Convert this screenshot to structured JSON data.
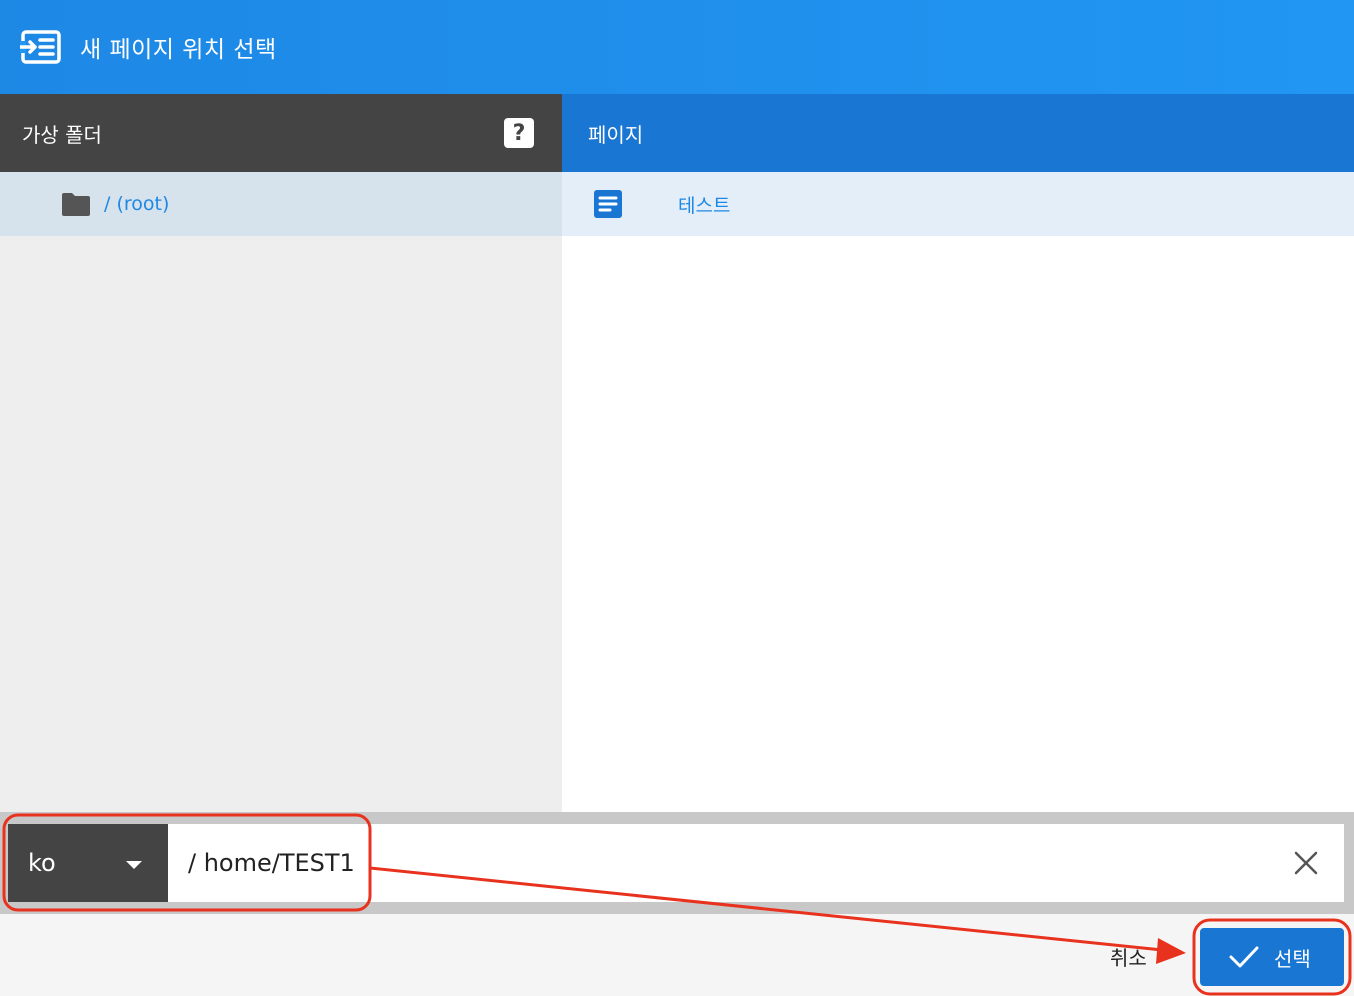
{
  "header": {
    "title": "새 페이지 위치 선택",
    "icon": "insert-list-icon"
  },
  "left_panel": {
    "heading": "가상 폴더",
    "help_label": "?",
    "folders": [
      {
        "label": "/ (root)",
        "icon": "folder-icon"
      }
    ]
  },
  "right_panel": {
    "heading": "페이지",
    "pages": [
      {
        "label": "테스트",
        "icon": "document-icon"
      }
    ]
  },
  "path_bar": {
    "locale": "ko",
    "path": "/ home/TEST1"
  },
  "footer": {
    "cancel_label": "취소",
    "select_label": "선택"
  },
  "colors": {
    "header": "#1e88e5",
    "dark_panel": "#444444",
    "accent": "#1976d2",
    "annotation": "#e8321e"
  }
}
